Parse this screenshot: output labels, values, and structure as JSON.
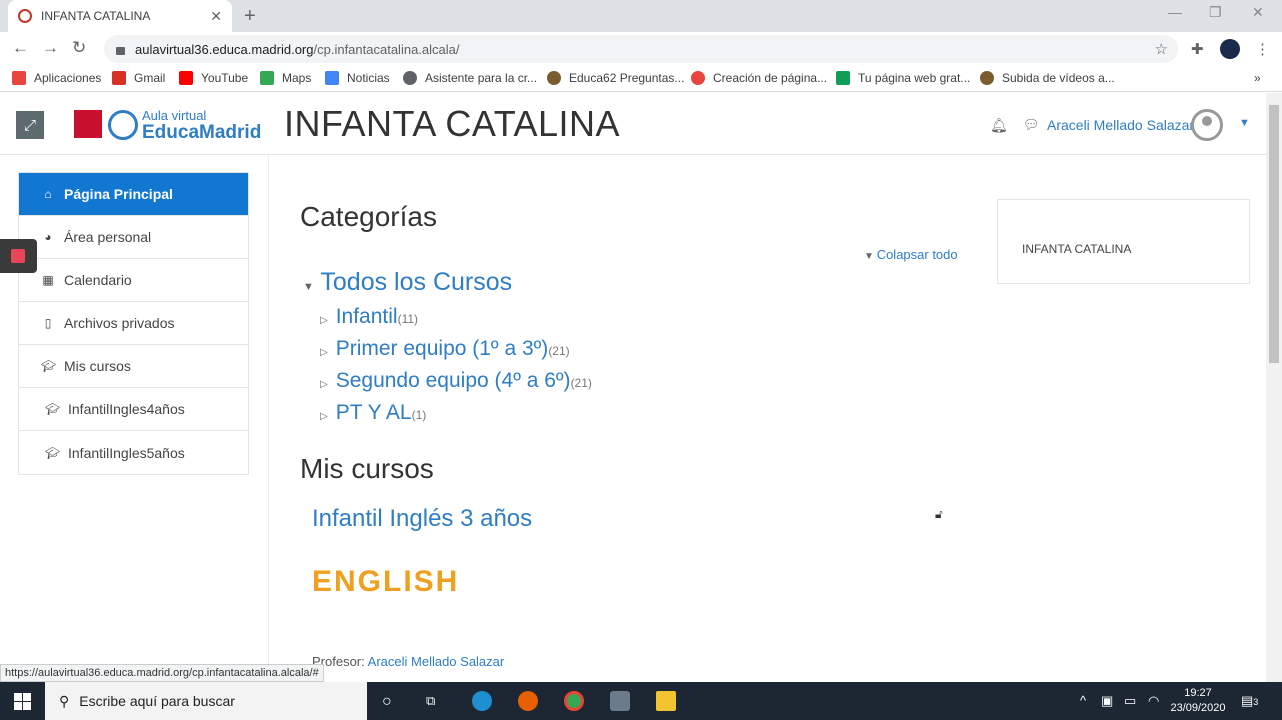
{
  "browser": {
    "tab_title": "INFANTA CATALINA",
    "tab_close": "✕",
    "new_tab": "+",
    "url_domain": "aulavirtual36.educa.madrid.org",
    "url_path": "/cp.infantacatalina.alcala/",
    "bookmarks": [
      {
        "label": "Aplicaciones",
        "color": "#e8453c"
      },
      {
        "label": "Gmail",
        "color": "#d93025"
      },
      {
        "label": "YouTube",
        "color": "#ff0000"
      },
      {
        "label": "Maps",
        "color": "#34a853"
      },
      {
        "label": "Noticias",
        "color": "#4285f4"
      },
      {
        "label": "Asistente para la cr...",
        "color": "#5f6368"
      },
      {
        "label": "Educa62 Preguntas...",
        "color": "#7a5c2e"
      },
      {
        "label": "Creación de página...",
        "color": "#e8453c"
      },
      {
        "label": "Tu página web grat...",
        "color": "#0f9d58"
      },
      {
        "label": "Subida de vídeos a...",
        "color": "#7a5c2e"
      }
    ],
    "more_bookmarks": "»",
    "status_url": "https://aulavirtual36.educa.madrid.org/cp.infantacatalina.alcala/#"
  },
  "header": {
    "logo_top": "Aula virtual",
    "logo_bottom": "EducaMadrid",
    "site_name": "INFANTA CATALINA",
    "user_name": "Araceli Mellado Salazar"
  },
  "sidebar": {
    "items": [
      {
        "label": "Página Principal",
        "icon": "home-icon"
      },
      {
        "label": "Área personal",
        "icon": "dashboard-icon"
      },
      {
        "label": "Calendario",
        "icon": "calendar-icon"
      },
      {
        "label": "Archivos privados",
        "icon": "file-icon"
      },
      {
        "label": "Mis cursos",
        "icon": "graduation-cap-icon"
      },
      {
        "label": "InfantilIngles4años",
        "icon": "graduation-cap-icon"
      },
      {
        "label": "InfantilIngles5años",
        "icon": "graduation-cap-icon"
      }
    ]
  },
  "main": {
    "categories_heading": "Categorías",
    "collapse_all": "Colapsar todo",
    "root_category": "Todos los Cursos",
    "categories": [
      {
        "name": "Infantil",
        "count": "(11)"
      },
      {
        "name": "Primer equipo (1º a 3º)",
        "count": "(21)"
      },
      {
        "name": "Segundo equipo (4º a 6º)",
        "count": "(21)"
      },
      {
        "name": "PT Y AL",
        "count": "(1)"
      }
    ],
    "my_courses_heading": "Mis cursos",
    "course_title": "Infantil Inglés 3 años",
    "course_image_text": "ENGLISH",
    "teacher_label": "Profesor:",
    "teacher_name": "Araceli Mellado Salazar"
  },
  "block": {
    "text": "INFANTA CATALINA"
  },
  "taskbar": {
    "search_placeholder": "Escribe aquí para buscar",
    "time": "19:27",
    "date": "23/09/2020",
    "notifications": "3"
  }
}
